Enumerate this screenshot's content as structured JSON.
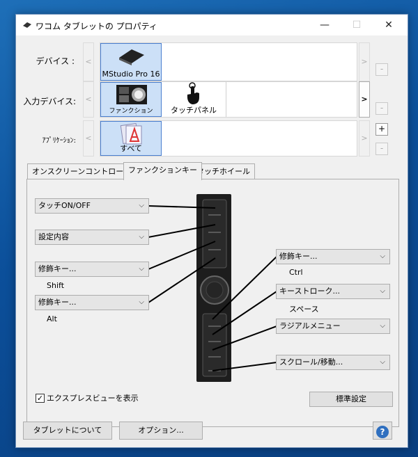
{
  "window": {
    "title": "ワコム タブレットの プロパティ",
    "controls": {
      "minimize": "—",
      "maximize": "☐",
      "close": "✕"
    }
  },
  "rows": {
    "device": {
      "label": "デバイス :",
      "items": [
        {
          "label": "MStudio Pro 16",
          "icon": "tablet-icon"
        }
      ]
    },
    "input": {
      "label": "入力デバイス:",
      "items": [
        {
          "label": "ファンクション",
          "icon": "function-keys-icon"
        },
        {
          "label": "タッチパネル",
          "icon": "touch-hand-icon"
        }
      ]
    },
    "app": {
      "label": "ｱﾌﾟﾘｹｰｼｮﾝ:",
      "items": [
        {
          "label": "すべて",
          "icon": "all-apps-icon"
        }
      ],
      "add": "+",
      "remove": "-"
    },
    "remove": "-",
    "left_arrow": "<",
    "right_arrow": ">"
  },
  "tabs": [
    {
      "label": "オンスクリーンコントロール"
    },
    {
      "label": "ファンクションキー"
    },
    {
      "label": "タッチホイール"
    }
  ],
  "left_dropdowns": [
    {
      "value": "タッチON/OFF",
      "sub": ""
    },
    {
      "value": "設定内容",
      "sub": ""
    },
    {
      "value": "修飾キー...",
      "sub": "Shift"
    },
    {
      "value": "修飾キー...",
      "sub": "Alt"
    }
  ],
  "right_dropdowns": [
    {
      "value": "修飾キー...",
      "sub": "Ctrl"
    },
    {
      "value": "キーストローク...",
      "sub": "スペース"
    },
    {
      "value": "ラジアルメニュー",
      "sub": ""
    },
    {
      "value": "スクロール/移動...",
      "sub": ""
    }
  ],
  "express_view": {
    "label": "エクスプレスビューを表示",
    "checked": true
  },
  "default_button": "標準設定",
  "footer": {
    "about": "タブレットについて",
    "options": "オプション...",
    "help": "?"
  },
  "colors": {
    "selection": "#cce0f7",
    "selection_border": "#4a7fd0",
    "help": "#2f6fbf"
  }
}
